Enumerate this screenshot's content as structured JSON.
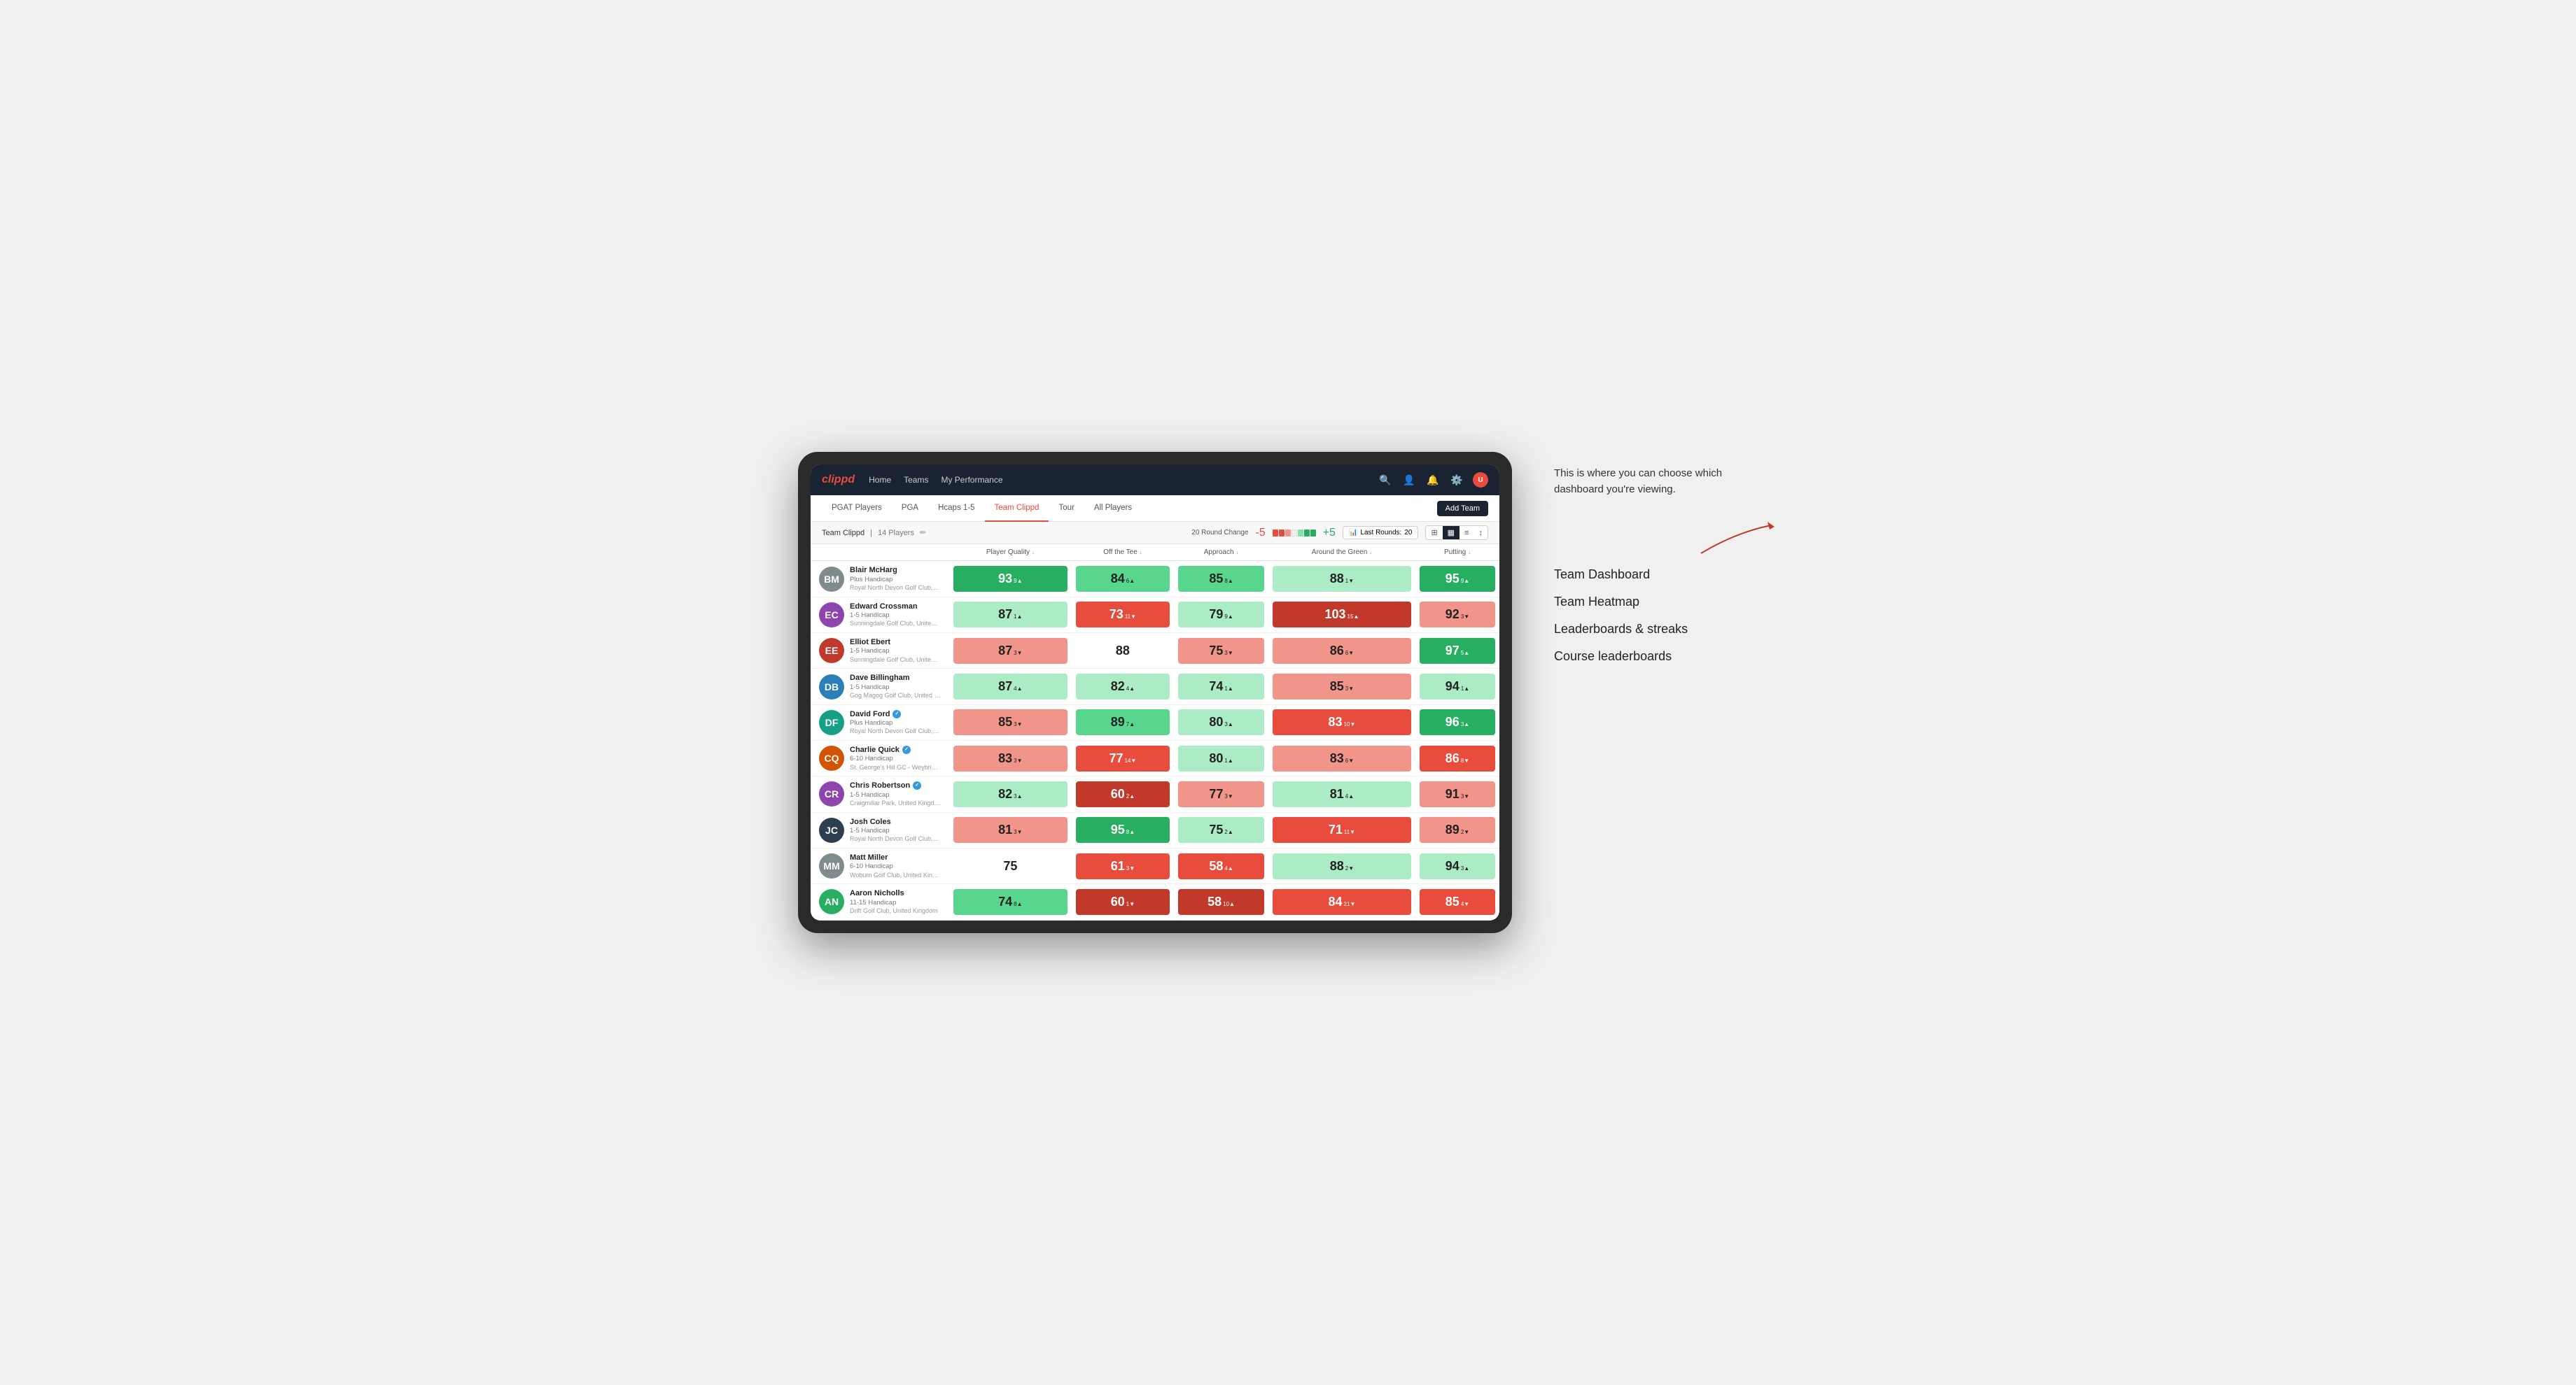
{
  "annotation": {
    "callout": "This is where you can choose which dashboard you're viewing.",
    "options": [
      "Team Dashboard",
      "Team Heatmap",
      "Leaderboards & streaks",
      "Course leaderboards"
    ]
  },
  "nav": {
    "logo": "clippd",
    "links": [
      "Home",
      "Teams",
      "My Performance"
    ],
    "icons": [
      "search",
      "person",
      "bell",
      "settings",
      "avatar"
    ]
  },
  "secondary_nav": {
    "tabs": [
      "PGAT Players",
      "PGA",
      "Hcaps 1-5",
      "Team Clippd",
      "Tour",
      "All Players"
    ],
    "active": "Team Clippd",
    "add_team_label": "Add Team"
  },
  "team_bar": {
    "team_name": "Team Clippd",
    "separator": "|",
    "player_count": "14 Players",
    "round_change_label": "20 Round Change",
    "minus_value": "-5",
    "plus_value": "+5",
    "last_rounds_label": "Last Rounds:",
    "last_rounds_value": "20"
  },
  "table": {
    "headers": [
      "Player Quality ↓",
      "Off the Tee ↓",
      "Approach ↓",
      "Around the Green ↓",
      "Putting ↓"
    ],
    "players": [
      {
        "name": "Blair McHarg",
        "handicap": "Plus Handicap",
        "club": "Royal North Devon Golf Club, United Kingdom",
        "avatar_color": "#7f8c8d",
        "initials": "BM",
        "stats": [
          {
            "value": "93",
            "change": "9",
            "dir": "up",
            "bg": "bg-green-strong"
          },
          {
            "value": "84",
            "change": "6",
            "dir": "up",
            "bg": "bg-green-med"
          },
          {
            "value": "85",
            "change": "8",
            "dir": "up",
            "bg": "bg-green-med"
          },
          {
            "value": "88",
            "change": "1",
            "dir": "down",
            "bg": "bg-green-light"
          },
          {
            "value": "95",
            "change": "9",
            "dir": "up",
            "bg": "bg-green-strong"
          }
        ]
      },
      {
        "name": "Edward Crossman",
        "handicap": "1-5 Handicap",
        "club": "Sunningdale Golf Club, United Kingdom",
        "avatar_color": "#8e44ad",
        "initials": "EC",
        "stats": [
          {
            "value": "87",
            "change": "1",
            "dir": "up",
            "bg": "bg-green-light"
          },
          {
            "value": "73",
            "change": "11",
            "dir": "down",
            "bg": "bg-red-med"
          },
          {
            "value": "79",
            "change": "9",
            "dir": "up",
            "bg": "bg-green-light"
          },
          {
            "value": "103",
            "change": "15",
            "dir": "up",
            "bg": "bg-red-strong"
          },
          {
            "value": "92",
            "change": "3",
            "dir": "down",
            "bg": "bg-red-light"
          }
        ]
      },
      {
        "name": "Elliot Ebert",
        "handicap": "1-5 Handicap",
        "club": "Sunningdale Golf Club, United Kingdom",
        "avatar_color": "#c0392b",
        "initials": "EE",
        "stats": [
          {
            "value": "87",
            "change": "3",
            "dir": "down",
            "bg": "bg-red-light"
          },
          {
            "value": "88",
            "change": "",
            "dir": "",
            "bg": "bg-white"
          },
          {
            "value": "75",
            "change": "3",
            "dir": "down",
            "bg": "bg-red-light"
          },
          {
            "value": "86",
            "change": "6",
            "dir": "down",
            "bg": "bg-red-light"
          },
          {
            "value": "97",
            "change": "5",
            "dir": "up",
            "bg": "bg-green-strong"
          }
        ]
      },
      {
        "name": "Dave Billingham",
        "handicap": "1-5 Handicap",
        "club": "Gog Magog Golf Club, United Kingdom",
        "avatar_color": "#2980b9",
        "initials": "DB",
        "stats": [
          {
            "value": "87",
            "change": "4",
            "dir": "up",
            "bg": "bg-green-light"
          },
          {
            "value": "82",
            "change": "4",
            "dir": "up",
            "bg": "bg-green-light"
          },
          {
            "value": "74",
            "change": "1",
            "dir": "up",
            "bg": "bg-green-light"
          },
          {
            "value": "85",
            "change": "3",
            "dir": "down",
            "bg": "bg-red-light"
          },
          {
            "value": "94",
            "change": "1",
            "dir": "up",
            "bg": "bg-green-light"
          }
        ]
      },
      {
        "name": "David Ford",
        "handicap": "Plus Handicap",
        "club": "Royal North Devon Golf Club, United Kingdom",
        "avatar_color": "#16a085",
        "initials": "DF",
        "verified": true,
        "stats": [
          {
            "value": "85",
            "change": "3",
            "dir": "down",
            "bg": "bg-red-light"
          },
          {
            "value": "89",
            "change": "7",
            "dir": "up",
            "bg": "bg-green-med"
          },
          {
            "value": "80",
            "change": "3",
            "dir": "up",
            "bg": "bg-green-light"
          },
          {
            "value": "83",
            "change": "10",
            "dir": "down",
            "bg": "bg-red-med"
          },
          {
            "value": "96",
            "change": "3",
            "dir": "up",
            "bg": "bg-green-strong"
          }
        ]
      },
      {
        "name": "Charlie Quick",
        "handicap": "6-10 Handicap",
        "club": "St. George's Hill GC - Weybridge - Surrey, Uni...",
        "avatar_color": "#d35400",
        "initials": "CQ",
        "verified": true,
        "stats": [
          {
            "value": "83",
            "change": "3",
            "dir": "down",
            "bg": "bg-red-light"
          },
          {
            "value": "77",
            "change": "14",
            "dir": "down",
            "bg": "bg-red-med"
          },
          {
            "value": "80",
            "change": "1",
            "dir": "up",
            "bg": "bg-green-light"
          },
          {
            "value": "83",
            "change": "6",
            "dir": "down",
            "bg": "bg-red-light"
          },
          {
            "value": "86",
            "change": "8",
            "dir": "down",
            "bg": "bg-red-med"
          }
        ]
      },
      {
        "name": "Chris Robertson",
        "handicap": "1-5 Handicap",
        "club": "Craigmillar Park, United Kingdom",
        "avatar_color": "#8e44ad",
        "initials": "CR",
        "verified": true,
        "stats": [
          {
            "value": "82",
            "change": "3",
            "dir": "up",
            "bg": "bg-green-light"
          },
          {
            "value": "60",
            "change": "2",
            "dir": "up",
            "bg": "bg-red-strong"
          },
          {
            "value": "77",
            "change": "3",
            "dir": "down",
            "bg": "bg-red-light"
          },
          {
            "value": "81",
            "change": "4",
            "dir": "up",
            "bg": "bg-green-light"
          },
          {
            "value": "91",
            "change": "3",
            "dir": "down",
            "bg": "bg-red-light"
          }
        ]
      },
      {
        "name": "Josh Coles",
        "handicap": "1-5 Handicap",
        "club": "Royal North Devon Golf Club, United Kingdom",
        "avatar_color": "#2c3e50",
        "initials": "JC",
        "stats": [
          {
            "value": "81",
            "change": "3",
            "dir": "down",
            "bg": "bg-red-light"
          },
          {
            "value": "95",
            "change": "8",
            "dir": "up",
            "bg": "bg-green-strong"
          },
          {
            "value": "75",
            "change": "2",
            "dir": "up",
            "bg": "bg-green-light"
          },
          {
            "value": "71",
            "change": "11",
            "dir": "down",
            "bg": "bg-red-med"
          },
          {
            "value": "89",
            "change": "2",
            "dir": "down",
            "bg": "bg-red-light"
          }
        ]
      },
      {
        "name": "Matt Miller",
        "handicap": "6-10 Handicap",
        "club": "Woburn Golf Club, United Kingdom",
        "avatar_color": "#7f8c8d",
        "initials": "MM",
        "stats": [
          {
            "value": "75",
            "change": "",
            "dir": "",
            "bg": "bg-white"
          },
          {
            "value": "61",
            "change": "3",
            "dir": "down",
            "bg": "bg-red-med"
          },
          {
            "value": "58",
            "change": "4",
            "dir": "up",
            "bg": "bg-red-med"
          },
          {
            "value": "88",
            "change": "2",
            "dir": "down",
            "bg": "bg-green-light"
          },
          {
            "value": "94",
            "change": "3",
            "dir": "up",
            "bg": "bg-green-light"
          }
        ]
      },
      {
        "name": "Aaron Nicholls",
        "handicap": "11-15 Handicap",
        "club": "Drift Golf Club, United Kingdom",
        "avatar_color": "#27ae60",
        "initials": "AN",
        "stats": [
          {
            "value": "74",
            "change": "8",
            "dir": "up",
            "bg": "bg-green-med"
          },
          {
            "value": "60",
            "change": "1",
            "dir": "down",
            "bg": "bg-red-strong"
          },
          {
            "value": "58",
            "change": "10",
            "dir": "up",
            "bg": "bg-red-strong"
          },
          {
            "value": "84",
            "change": "21",
            "dir": "down",
            "bg": "bg-red-med"
          },
          {
            "value": "85",
            "change": "4",
            "dir": "down",
            "bg": "bg-red-med"
          }
        ]
      }
    ]
  }
}
